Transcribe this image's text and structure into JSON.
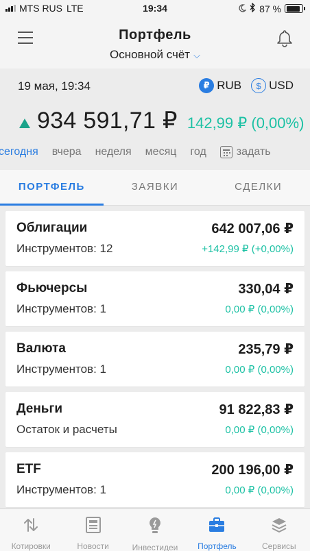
{
  "status_bar": {
    "carrier": "MTS RUS",
    "network": "LTE",
    "time": "19:34",
    "battery": "87 %",
    "battery_level": 0.87
  },
  "header": {
    "title": "Портфель",
    "account": "Основной счёт"
  },
  "summary": {
    "date": "19 мая, 19:34",
    "currency_rub_symbol": "₽",
    "currency_rub": "RUB",
    "currency_usd_symbol": "$",
    "currency_usd": "USD",
    "total_value": "934 591,71 ₽",
    "total_change": "142,99 ₽ (0,00%)",
    "trend": "up"
  },
  "periods": [
    {
      "label": "сегодня",
      "active": true
    },
    {
      "label": "вчера",
      "active": false
    },
    {
      "label": "неделя",
      "active": false
    },
    {
      "label": "месяц",
      "active": false
    },
    {
      "label": "год",
      "active": false
    }
  ],
  "period_custom": "задать",
  "tabs": [
    {
      "label": "ПОРТФЕЛЬ",
      "active": true
    },
    {
      "label": "ЗАЯВКИ",
      "active": false
    },
    {
      "label": "СДЕЛКИ",
      "active": false
    }
  ],
  "holdings": [
    {
      "name": "Облигации",
      "sub": "Инструментов: 12",
      "value": "642 007,06 ₽",
      "change": "+142,99 ₽ (+0,00%)"
    },
    {
      "name": "Фьючерсы",
      "sub": "Инструментов: 1",
      "value": "330,04 ₽",
      "change": "0,00 ₽ (0,00%)"
    },
    {
      "name": "Валюта",
      "sub": "Инструментов: 1",
      "value": "235,79 ₽",
      "change": "0,00 ₽ (0,00%)"
    },
    {
      "name": "Деньги",
      "sub": "Остаток и расчеты",
      "value": "91 822,83 ₽",
      "change": "0,00 ₽ (0,00%)"
    },
    {
      "name": "ETF",
      "sub": "Инструментов: 1",
      "value": "200 196,00 ₽",
      "change": "0,00 ₽ (0,00%)"
    }
  ],
  "bottom_nav": [
    {
      "label": "Котировки",
      "icon": "arrows-updown-icon",
      "active": false
    },
    {
      "label": "Новости",
      "icon": "newspaper-icon",
      "active": false
    },
    {
      "label": "Инвестидеи",
      "icon": "lightbulb-icon",
      "active": false
    },
    {
      "label": "Портфель",
      "icon": "briefcase-icon",
      "active": true
    },
    {
      "label": "Сервисы",
      "icon": "layers-icon",
      "active": false
    }
  ],
  "colors": {
    "accent": "#2a7de1",
    "positive": "#1cc1a4",
    "trend_up": "#1aa38a"
  }
}
